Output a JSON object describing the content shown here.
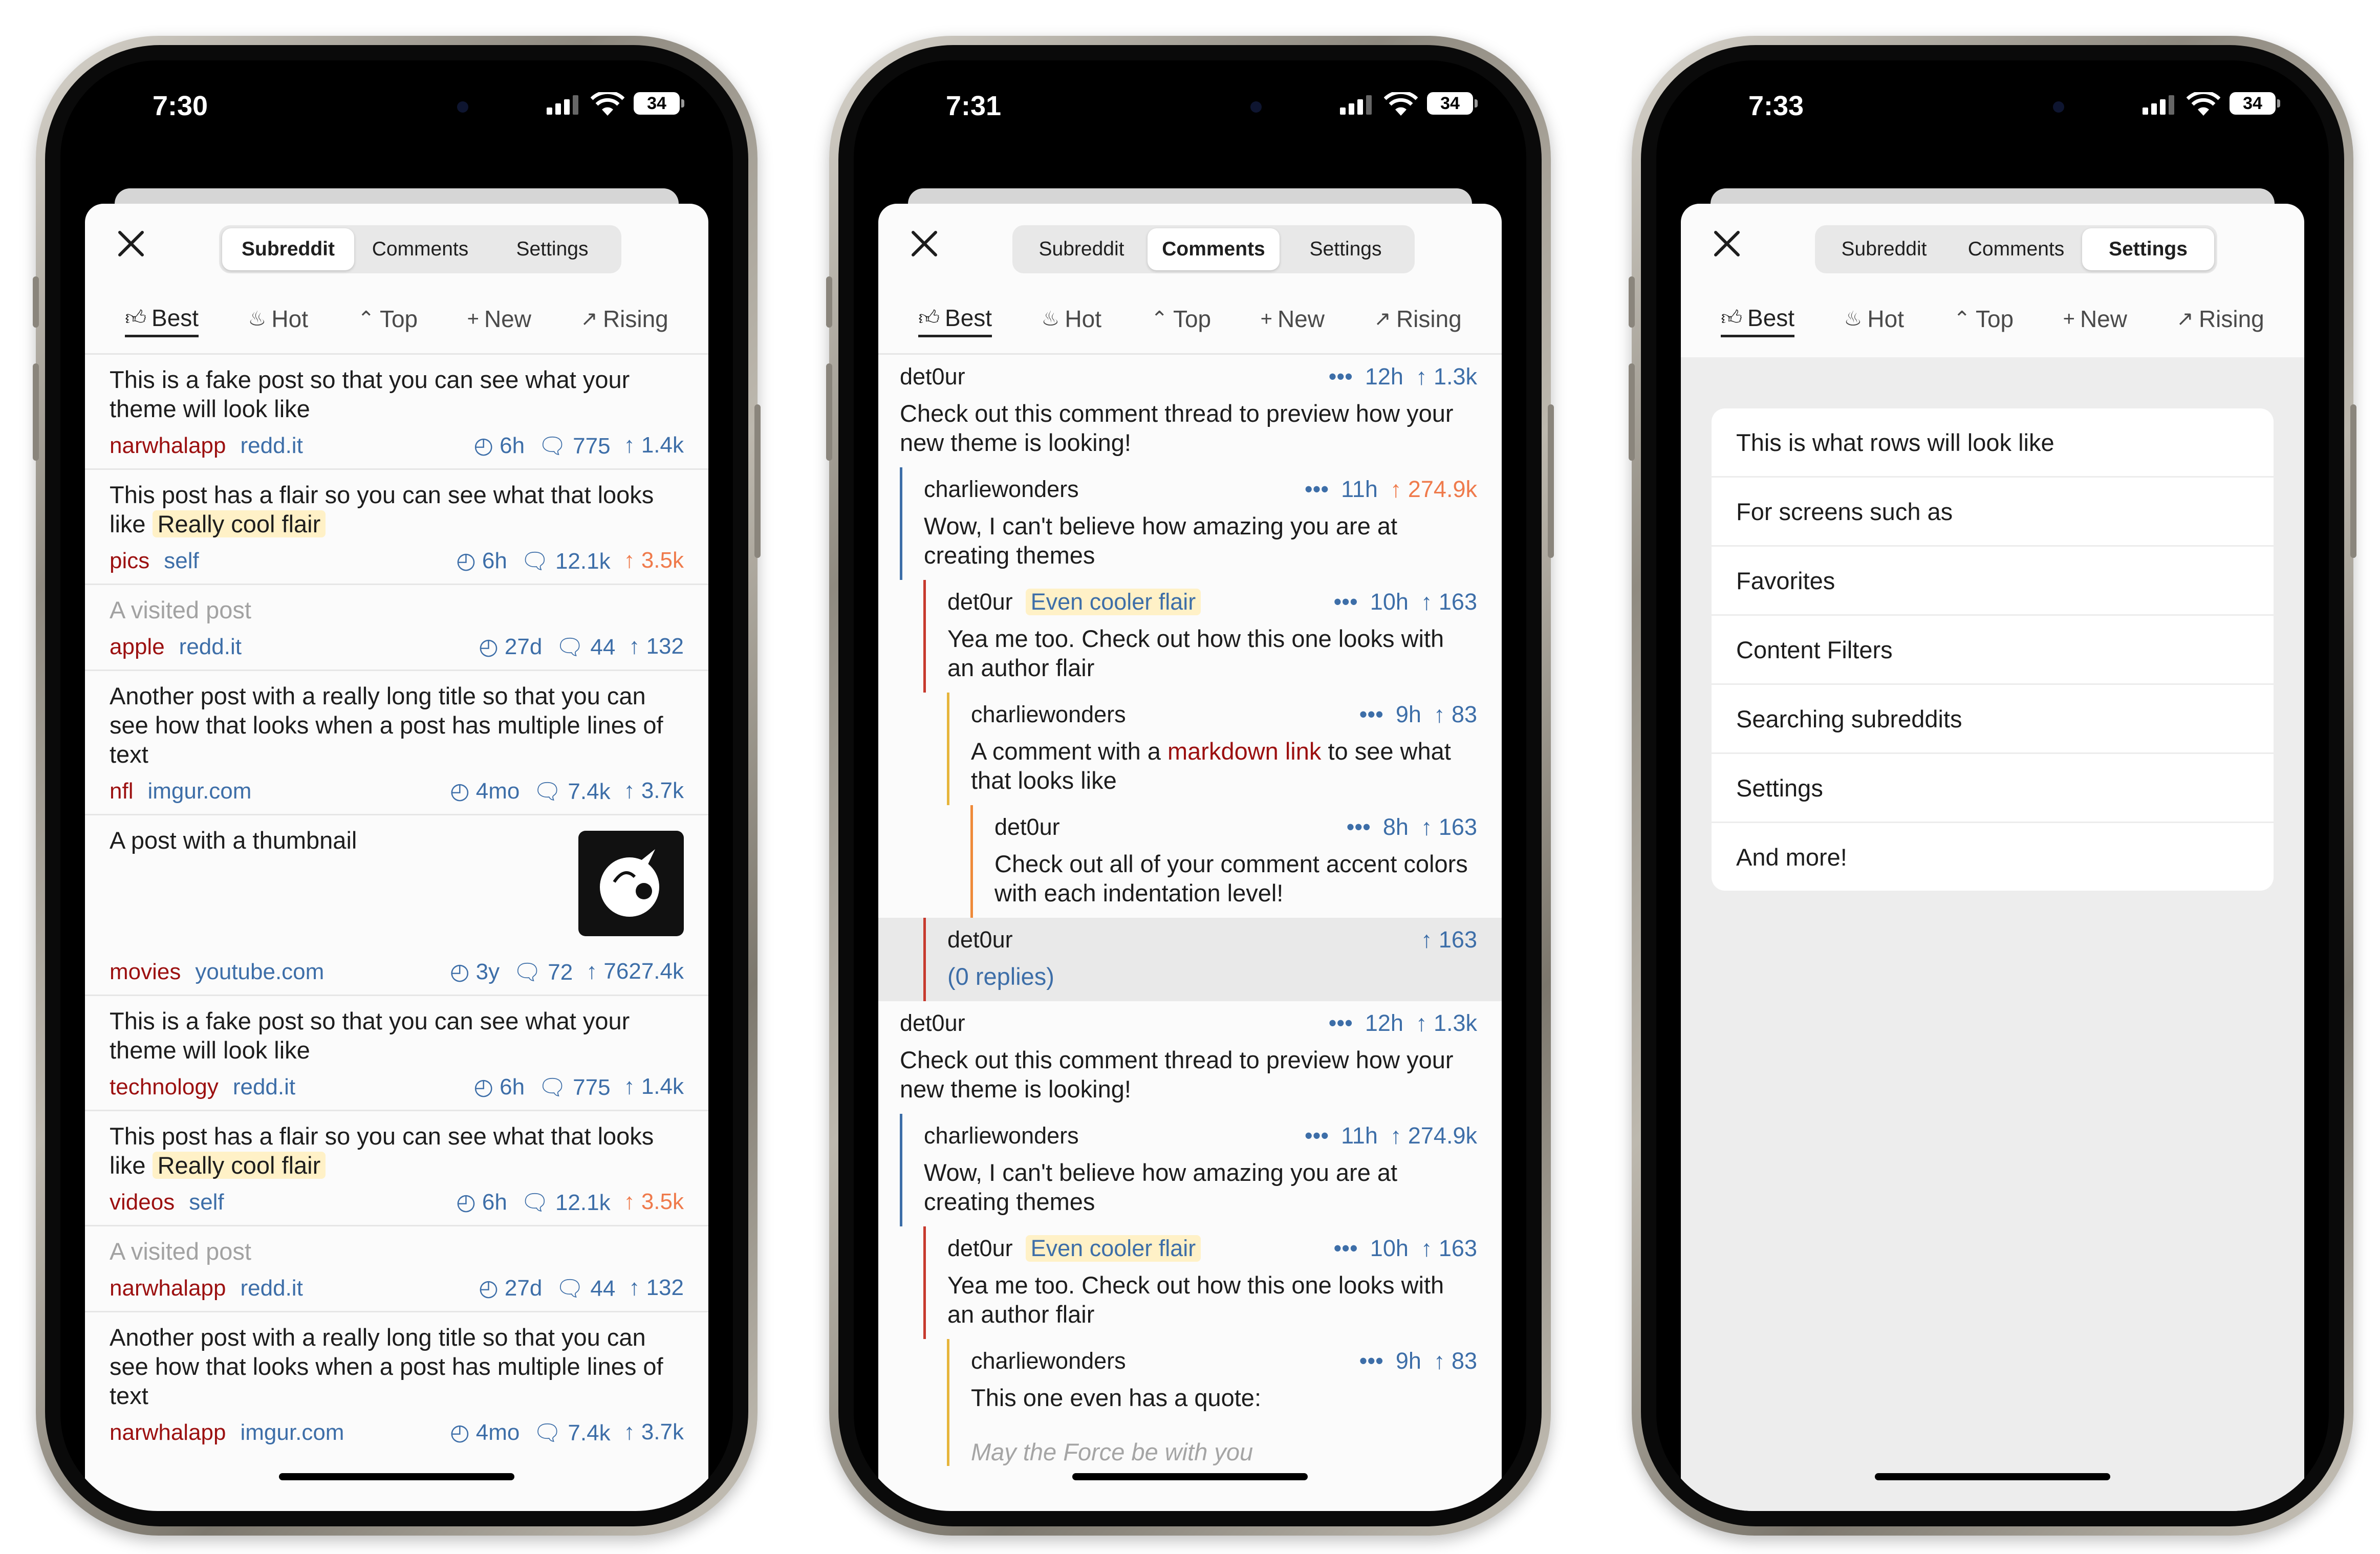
{
  "phones": [
    {
      "time": "7:30",
      "battery": "34"
    },
    {
      "time": "7:31",
      "battery": "34"
    },
    {
      "time": "7:33",
      "battery": "34"
    }
  ],
  "tabs": [
    "Subreddit",
    "Comments",
    "Settings"
  ],
  "sorts": [
    "Best",
    "Hot",
    "Top",
    "New",
    "Rising"
  ],
  "posts": [
    {
      "title": "This is a fake post so that you can see what your theme will look like",
      "sub": "narwhalapp",
      "domain": "redd.it",
      "age": "6h",
      "comments": "775",
      "score": "1.4k"
    },
    {
      "title": "This post has a flair so you can see what that looks like",
      "flair": "Really cool flair",
      "sub": "pics",
      "domain": "self",
      "age": "6h",
      "comments": "12.1k",
      "score": "3.5k"
    },
    {
      "title": "A visited post",
      "sub": "apple",
      "domain": "redd.it",
      "age": "27d",
      "comments": "44",
      "score": "132"
    },
    {
      "title": "Another post with a really long title so that you can see how that looks when a post has multiple lines of text",
      "sub": "nfl",
      "domain": "imgur.com",
      "age": "4mo",
      "comments": "7.4k",
      "score": "3.7k"
    },
    {
      "title": "A post with a thumbnail",
      "sub": "movies",
      "domain": "youtube.com",
      "age": "3y",
      "comments": "72",
      "score": "7627.4k"
    },
    {
      "title": "This is a fake post so that you can see what your theme will look like",
      "sub": "technology",
      "domain": "redd.it",
      "age": "6h",
      "comments": "775",
      "score": "1.4k"
    },
    {
      "title": "This post has a flair so you can see what that looks like",
      "flair": "Really cool flair",
      "sub": "videos",
      "domain": "self",
      "age": "6h",
      "comments": "12.1k",
      "score": "3.5k"
    },
    {
      "title": "A visited post",
      "sub": "narwhalapp",
      "domain": "redd.it",
      "age": "27d",
      "comments": "44",
      "score": "132"
    },
    {
      "title": "Another post with a really long title so that you can see how that looks when a post has multiple lines of text",
      "sub": "narwhalapp",
      "domain": "imgur.com",
      "age": "4mo",
      "comments": "7.4k",
      "score": "3.7k"
    }
  ],
  "comments": {
    "more": "•••",
    "c1_author": "det0ur",
    "c1_age": "12h",
    "c1_score": "1.3k",
    "c1_body": "Check out this comment thread to preview how your new theme is looking!",
    "c2_author": "charliewonders",
    "c2_age": "11h",
    "c2_score": "274.9k",
    "c2_body": "Wow, I can't believe how amazing you are at creating themes",
    "c3_author": "det0ur",
    "c3_flair": "Even cooler flair",
    "c3_age": "10h",
    "c3_score": "163",
    "c3_body": "Yea me too. Check out how this one looks with an author flair",
    "c4_author": "charliewonders",
    "c4_age": "9h",
    "c4_score": "83",
    "c4_body_a": "A comment with a ",
    "c4_link": "markdown link",
    "c4_body_b": " to see what that looks like",
    "c5_author": "det0ur",
    "c5_age": "8h",
    "c5_score": "163",
    "c5_body": "Check out all of your comment accent colors with each indentation level!",
    "c6_author": "det0ur",
    "c6_score": "163",
    "c6_replies": "(0 replies)",
    "c10_body": "This one even has a quote:",
    "c10_quote": "May the Force be with you"
  },
  "settings_rows": [
    "This is what rows will look like",
    "For screens such as",
    "Favorites",
    "Content Filters",
    "Searching subreddits",
    "Settings",
    "And more!"
  ],
  "colors": {
    "indent1": "#3d6ea8",
    "indent2": "#c73a2e",
    "indent3": "#e6b53c",
    "indent4": "#ef8a3a",
    "score_hot": "#ef7a4b"
  }
}
